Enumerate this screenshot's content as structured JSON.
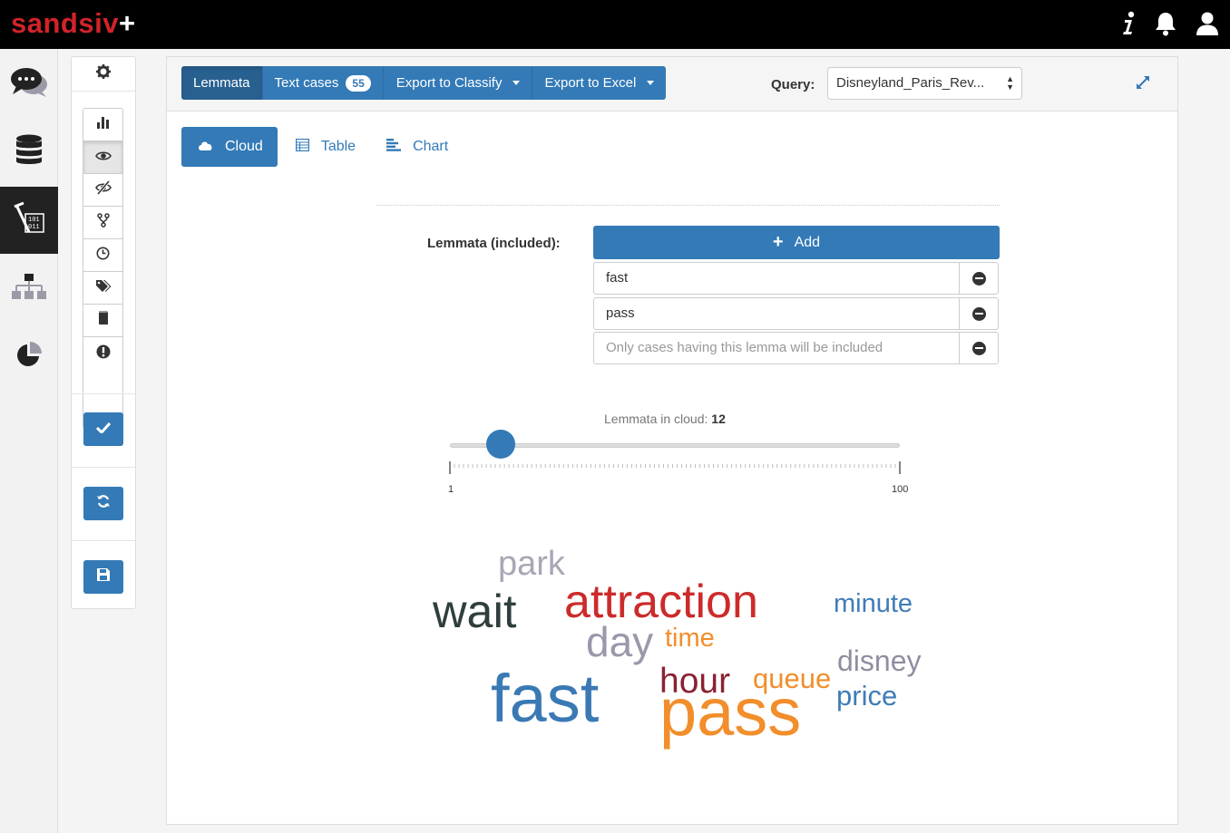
{
  "brand": {
    "name": "sandsiv",
    "plus": "+"
  },
  "topbar": {
    "info_icon": "info-icon",
    "bell_icon": "bell-icon",
    "user_icon": "user-icon"
  },
  "leftnav": [
    {
      "name": "comments-icon",
      "active": false
    },
    {
      "name": "database-icon",
      "active": false
    },
    {
      "name": "binary-analytics-icon",
      "active": true
    },
    {
      "name": "sitemap-icon",
      "active": false
    },
    {
      "name": "pie-chart-icon",
      "active": false
    }
  ],
  "tools": [
    "bar-chart-icon",
    "eye-icon",
    "eye-slash-icon",
    "branch-icon",
    "clock-icon",
    "tags-icon",
    "book-icon",
    "exclamation-icon"
  ],
  "header": {
    "tabs": [
      {
        "label": "Lemmata",
        "active": true
      },
      {
        "label": "Text cases",
        "badge": "55"
      },
      {
        "label": "Export to Classify",
        "dropdown": true
      },
      {
        "label": "Export to Excel",
        "dropdown": true
      }
    ],
    "query_label": "Query:",
    "query_value": "Disneyland_Paris_Rev..."
  },
  "view_tabs": [
    {
      "label": "Cloud",
      "active": true,
      "icon": "cloud-icon"
    },
    {
      "label": "Table",
      "active": false,
      "icon": "table-icon"
    },
    {
      "label": "Chart",
      "active": false,
      "icon": "chart-icon"
    }
  ],
  "lemmata": {
    "label": "Lemmata (included):",
    "add_label": "Add",
    "items": [
      "fast",
      "pass"
    ],
    "placeholder": "Only cases having this lemma will be included"
  },
  "slider": {
    "label": "Lemmata in cloud:",
    "value": "12",
    "min": "1",
    "max": "100"
  },
  "colors": {
    "primary": "#337ab7",
    "red": "#cc2b2b",
    "orange": "#f28e2b",
    "gray": "#9a98aa",
    "dark": "#2f3e3e",
    "maroon": "#8a2233"
  },
  "cloud": [
    {
      "text": "park",
      "color": "#a7a7b7"
    },
    {
      "text": "wait",
      "color": "#2f3e3e"
    },
    {
      "text": "attraction",
      "color": "#cc2b2b"
    },
    {
      "text": "minute",
      "color": "#3f7cb7"
    },
    {
      "text": "day",
      "color": "#9a98aa"
    },
    {
      "text": "time",
      "color": "#f28e2b"
    },
    {
      "text": "disney",
      "color": "#8f8ea0"
    },
    {
      "text": "hour",
      "color": "#8a2233"
    },
    {
      "text": "queue",
      "color": "#f28e2b"
    },
    {
      "text": "price",
      "color": "#3f7cb7"
    },
    {
      "text": "fast",
      "color": "#3a79b4"
    },
    {
      "text": "pass",
      "color": "#f28e2b"
    }
  ]
}
